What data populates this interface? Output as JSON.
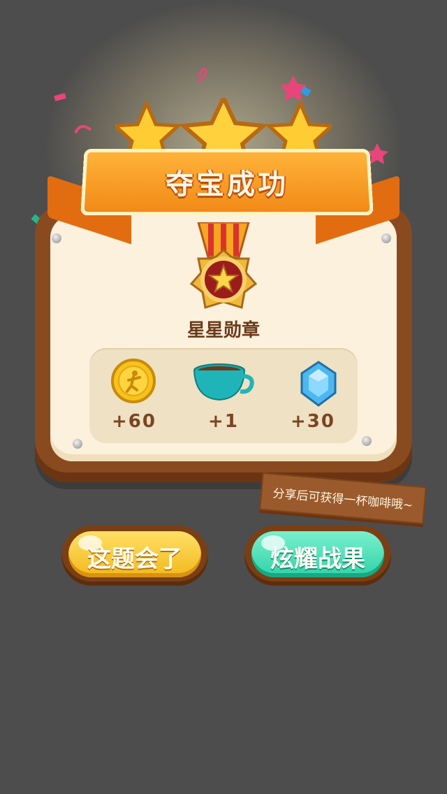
{
  "banner": {
    "title": "夺宝成功"
  },
  "medal": {
    "name": "星星勋章"
  },
  "rewards": [
    {
      "icon": "gold-coin-icon",
      "value": "+60"
    },
    {
      "icon": "coffee-cup-icon",
      "value": "+1"
    },
    {
      "icon": "diamond-icon",
      "value": "+30"
    }
  ],
  "share_hint": "分享后可获得一杯咖啡哦~",
  "buttons": {
    "left": "这题会了",
    "right": "炫耀战果"
  },
  "colors": {
    "background": "#4d4d4d",
    "left_button": "#f2b81c",
    "right_button": "#2fd2a8",
    "wood": "#8a4a1f"
  }
}
